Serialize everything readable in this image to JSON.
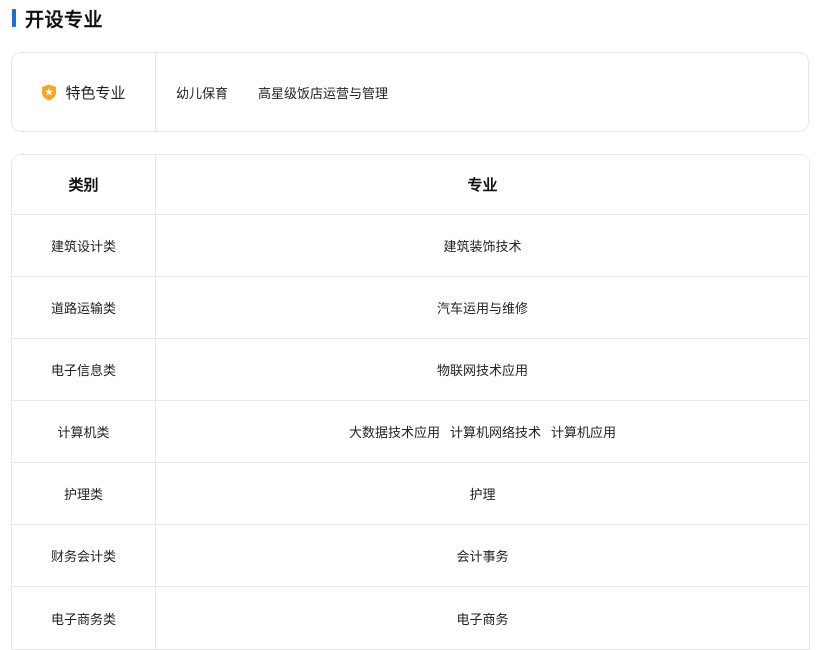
{
  "section": {
    "title": "开设专业"
  },
  "featured": {
    "label": "特色专业",
    "items": [
      "幼儿保育",
      "高星级饭店运营与管理"
    ]
  },
  "table": {
    "headers": {
      "category": "类别",
      "majors": "专业"
    },
    "rows": [
      {
        "category": "建筑设计类",
        "majors": [
          "建筑装饰技术"
        ]
      },
      {
        "category": "道路运输类",
        "majors": [
          "汽车运用与维修"
        ]
      },
      {
        "category": "电子信息类",
        "majors": [
          "物联网技术应用"
        ]
      },
      {
        "category": "计算机类",
        "majors": [
          "大数据技术应用",
          "计算机网络技术",
          "计算机应用"
        ]
      },
      {
        "category": "护理类",
        "majors": [
          "护理"
        ]
      },
      {
        "category": "财务会计类",
        "majors": [
          "会计事务"
        ]
      },
      {
        "category": "电子商务类",
        "majors": [
          "电子商务"
        ]
      }
    ]
  },
  "colors": {
    "accent": "#1f6fd1",
    "badge": "#f5a623",
    "border": "#e5e8ee"
  }
}
